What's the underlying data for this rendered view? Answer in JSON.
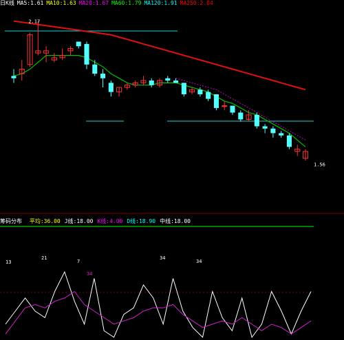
{
  "header": {
    "items": [
      {
        "text": "日K线",
        "color": "#ffffff"
      },
      {
        "text": "MA5:1.61",
        "color": "#ffffff"
      },
      {
        "text": "MA10:1.63",
        "color": "#ffff00"
      },
      {
        "text": "MA20:1.67",
        "color": "#ff00ff"
      },
      {
        "text": "MA60:1.79",
        "color": "#00ff00"
      },
      {
        "text": "MA120:1.91",
        "color": "#00ffff"
      },
      {
        "text": "MA250:2.04",
        "color": "#ff0000"
      }
    ]
  },
  "price_chart": {
    "high_label": "2.17",
    "low_label": "1.56",
    "colors": {
      "up": "#ff3232",
      "down": "#54ffff",
      "ma_short": "#00c000",
      "ma_mid": "#c000c0",
      "ma_long": "#e01010",
      "hline": "#1ed2d2"
    }
  },
  "indicator": {
    "name": "筹码分布",
    "items": [
      {
        "text": "平均:36.00",
        "color": "#ffff00"
      },
      {
        "text": "J线:18.00",
        "color": "#ffffff"
      },
      {
        "text": "K线:4.00",
        "color": "#ff00ff"
      },
      {
        "text": "D线:18.90",
        "color": "#00ffff"
      },
      {
        "text": "中线:18.00",
        "color": "#ffffff"
      }
    ],
    "peak_labels": [
      "13",
      "21",
      "7",
      "34",
      "34"
    ],
    "marker_label": "34",
    "colors": {
      "j_line": "#ffffff",
      "k_line": "#d020d0",
      "ref_line": "#00ff00"
    }
  },
  "chart_data": {
    "type": "candlestick",
    "candles": [
      {
        "o": 1.93,
        "h": 1.96,
        "l": 1.9,
        "c": 1.92
      },
      {
        "o": 1.94,
        "h": 2.0,
        "l": 1.91,
        "c": 1.96
      },
      {
        "o": 1.98,
        "h": 2.12,
        "l": 1.97,
        "c": 2.11
      },
      {
        "o": 2.03,
        "h": 2.17,
        "l": 2.02,
        "c": 2.04
      },
      {
        "o": 2.03,
        "h": 2.06,
        "l": 1.99,
        "c": 2.04
      },
      {
        "o": 2.0,
        "h": 2.03,
        "l": 1.99,
        "c": 2.01
      },
      {
        "o": 2.01,
        "h": 2.05,
        "l": 2.0,
        "c": 2.02
      },
      {
        "o": 2.04,
        "h": 2.06,
        "l": 2.02,
        "c": 2.05
      },
      {
        "o": 2.08,
        "h": 2.08,
        "l": 2.05,
        "c": 2.06
      },
      {
        "o": 2.07,
        "h": 2.08,
        "l": 1.96,
        "c": 1.98
      },
      {
        "o": 1.98,
        "h": 2.0,
        "l": 1.93,
        "c": 1.94
      },
      {
        "o": 1.94,
        "h": 1.96,
        "l": 1.88,
        "c": 1.92
      },
      {
        "o": 1.9,
        "h": 1.91,
        "l": 1.84,
        "c": 1.86
      },
      {
        "o": 1.86,
        "h": 1.88,
        "l": 1.84,
        "c": 1.88
      },
      {
        "o": 1.88,
        "h": 1.9,
        "l": 1.87,
        "c": 1.89
      },
      {
        "o": 1.89,
        "h": 1.91,
        "l": 1.88,
        "c": 1.9
      },
      {
        "o": 1.9,
        "h": 1.93,
        "l": 1.89,
        "c": 1.91
      },
      {
        "o": 1.91,
        "h": 1.92,
        "l": 1.88,
        "c": 1.89
      },
      {
        "o": 1.89,
        "h": 1.92,
        "l": 1.88,
        "c": 1.91
      },
      {
        "o": 1.92,
        "h": 1.93,
        "l": 1.9,
        "c": 1.91
      },
      {
        "o": 1.91,
        "h": 1.92,
        "l": 1.9,
        "c": 1.9
      },
      {
        "o": 1.9,
        "h": 1.9,
        "l": 1.84,
        "c": 1.85
      },
      {
        "o": 1.86,
        "h": 1.88,
        "l": 1.85,
        "c": 1.87
      },
      {
        "o": 1.87,
        "h": 1.88,
        "l": 1.84,
        "c": 1.85
      },
      {
        "o": 1.86,
        "h": 1.87,
        "l": 1.82,
        "c": 1.83
      },
      {
        "o": 1.85,
        "h": 1.85,
        "l": 1.78,
        "c": 1.79
      },
      {
        "o": 1.8,
        "h": 1.82,
        "l": 1.78,
        "c": 1.8
      },
      {
        "o": 1.8,
        "h": 1.8,
        "l": 1.76,
        "c": 1.77
      },
      {
        "o": 1.77,
        "h": 1.78,
        "l": 1.73,
        "c": 1.74
      },
      {
        "o": 1.74,
        "h": 1.78,
        "l": 1.73,
        "c": 1.76
      },
      {
        "o": 1.76,
        "h": 1.77,
        "l": 1.7,
        "c": 1.71
      },
      {
        "o": 1.71,
        "h": 1.72,
        "l": 1.68,
        "c": 1.7
      },
      {
        "o": 1.7,
        "h": 1.71,
        "l": 1.66,
        "c": 1.68
      },
      {
        "o": 1.68,
        "h": 1.69,
        "l": 1.66,
        "c": 1.67
      },
      {
        "o": 1.67,
        "h": 1.68,
        "l": 1.61,
        "c": 1.62
      },
      {
        "o": 1.6,
        "h": 1.63,
        "l": 1.58,
        "c": 1.61
      },
      {
        "o": 1.57,
        "h": 1.61,
        "l": 1.56,
        "c": 1.6
      }
    ],
    "ma_short": [
      1.93,
      1.94,
      1.96,
      1.99,
      2.02,
      2.02,
      2.02,
      2.02,
      2.02,
      2.01,
      1.99,
      1.97,
      1.94,
      1.92,
      1.9,
      1.89,
      1.89,
      1.89,
      1.9,
      1.9,
      1.9,
      1.89,
      1.88,
      1.87,
      1.86,
      1.84,
      1.82,
      1.81,
      1.79,
      1.77,
      1.76,
      1.74,
      1.72,
      1.7,
      1.68,
      1.65,
      1.62
    ],
    "ma_mid": [
      null,
      null,
      null,
      null,
      null,
      null,
      null,
      null,
      null,
      null,
      null,
      null,
      null,
      null,
      null,
      null,
      null,
      null,
      null,
      null,
      1.92,
      1.91,
      1.9,
      1.89,
      1.88,
      1.87,
      1.85,
      1.83,
      1.81,
      1.79,
      1.77,
      1.75,
      1.73,
      1.71,
      1.69,
      1.67,
      1.65
    ],
    "ma_long": [
      2.17,
      2.165,
      2.16,
      2.155,
      2.15,
      2.145,
      2.14,
      2.135,
      2.13,
      2.125,
      2.12,
      2.115,
      2.11,
      2.1,
      2.09,
      2.08,
      2.07,
      2.06,
      2.05,
      2.04,
      2.03,
      2.02,
      2.01,
      2.0,
      1.99,
      1.98,
      1.97,
      1.96,
      1.95,
      1.94,
      1.93,
      1.92,
      1.91,
      1.9,
      1.89,
      1.88,
      1.87
    ],
    "ylim": [
      1.54,
      2.22
    ],
    "indicator_j": [
      20,
      40,
      60,
      40,
      30,
      70,
      100,
      55,
      20,
      90,
      10,
      0,
      35,
      45,
      80,
      60,
      20,
      90,
      40,
      15,
      0,
      70,
      30,
      10,
      60,
      0,
      20,
      70,
      40,
      5,
      40,
      70
    ],
    "indicator_k": [
      5,
      25,
      45,
      50,
      45,
      55,
      60,
      70,
      50,
      40,
      30,
      20,
      25,
      30,
      40,
      45,
      45,
      50,
      35,
      25,
      15,
      20,
      25,
      20,
      30,
      20,
      10,
      20,
      15,
      5,
      15,
      25
    ]
  }
}
